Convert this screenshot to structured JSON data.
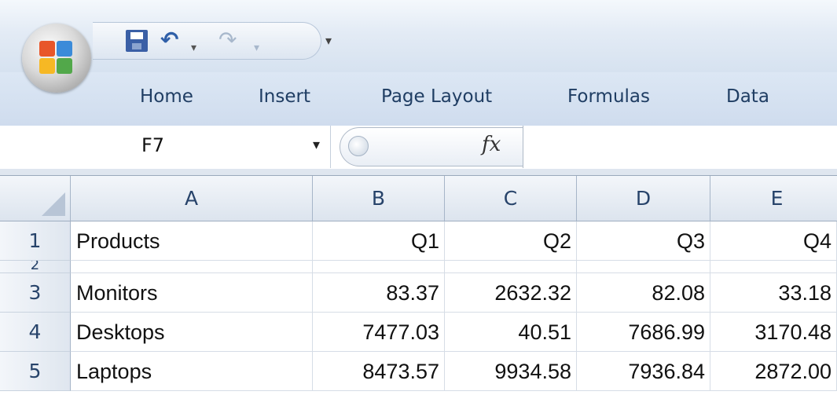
{
  "quick_access": {
    "save_icon": "save-icon",
    "undo_icon": "undo-icon",
    "redo_icon": "redo-icon",
    "undo_symbol": "↶",
    "redo_symbol": "↷",
    "dropdown_symbol": "▾",
    "customize_symbol": "▾"
  },
  "ribbon": {
    "tabs": [
      {
        "label": "Home"
      },
      {
        "label": "Insert"
      },
      {
        "label": "Page Layout"
      },
      {
        "label": "Formulas"
      },
      {
        "label": "Data"
      }
    ]
  },
  "formula_bar": {
    "name_box": "F7",
    "dropdown_symbol": "▾",
    "fx_label": "fx",
    "formula_value": ""
  },
  "grid": {
    "columns": [
      "A",
      "B",
      "C",
      "D",
      "E"
    ],
    "rows": [
      {
        "num": "1",
        "cells": [
          "Products",
          "Q1",
          "Q2",
          "Q3",
          "Q4"
        ]
      },
      {
        "num": "2",
        "cells": [
          "",
          "",
          "",
          "",
          ""
        ]
      },
      {
        "num": "3",
        "cells": [
          "Monitors",
          "83.37",
          "2632.32",
          "82.08",
          "33.18"
        ]
      },
      {
        "num": "4",
        "cells": [
          "Desktops",
          "7477.03",
          "40.51",
          "7686.99",
          "3170.48"
        ]
      },
      {
        "num": "5",
        "cells": [
          "Laptops",
          "8473.57",
          "9934.58",
          "7936.84",
          "2872.00"
        ]
      }
    ]
  },
  "colors": {
    "ribbon_blue": "#cfdcee",
    "tab_text": "#1f3d63",
    "header_text": "#27436a"
  }
}
